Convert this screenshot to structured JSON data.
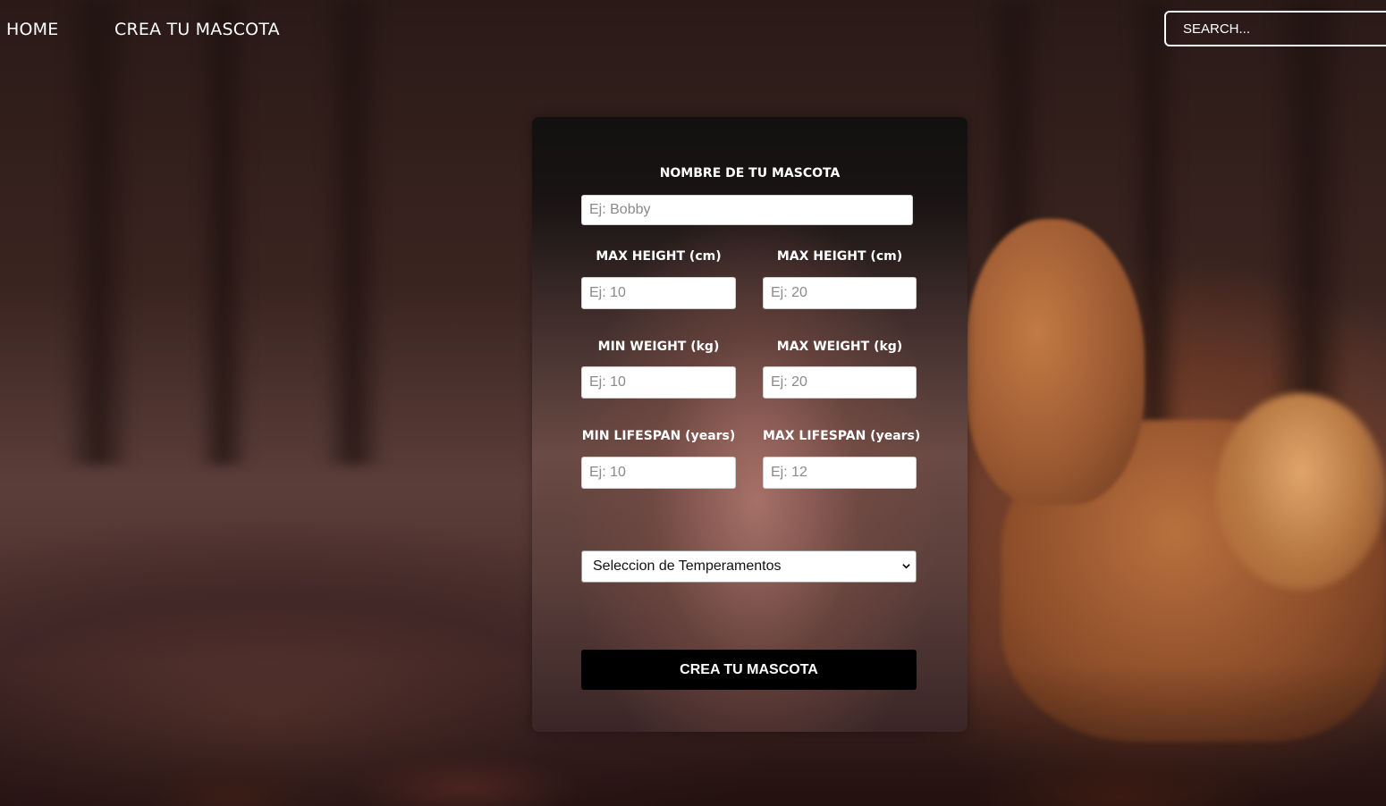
{
  "nav": {
    "home_label": "HOME",
    "create_label": "CREA TU MASCOTA",
    "search_placeholder": "SEARCH..."
  },
  "form": {
    "name_label": "NOMBRE DE TU MASCOTA",
    "name_placeholder": "Ej: Bobby",
    "min_height_label": "MAX HEIGHT (cm)",
    "min_height_placeholder": "Ej: 10",
    "max_height_label": "MAX HEIGHT (cm)",
    "max_height_placeholder": "Ej: 20",
    "min_weight_label": "MIN WEIGHT (kg)",
    "min_weight_placeholder": "Ej: 10",
    "max_weight_label": "MAX WEIGHT (kg)",
    "max_weight_placeholder": "Ej: 20",
    "min_lifespan_label": "MIN LIFESPAN (years)",
    "min_lifespan_placeholder": "Ej: 10",
    "max_lifespan_label": "MAX LIFESPAN (years)",
    "max_lifespan_placeholder": "Ej: 12",
    "temperament_selected": "Seleccion de Temperamentos",
    "submit_label": "CREA TU MASCOTA"
  },
  "icons": {
    "select_chevron": "chevron-down-icon"
  },
  "colors": {
    "nav_text": "#ffffff",
    "button_bg": "#000000",
    "button_text": "#ffffff"
  }
}
